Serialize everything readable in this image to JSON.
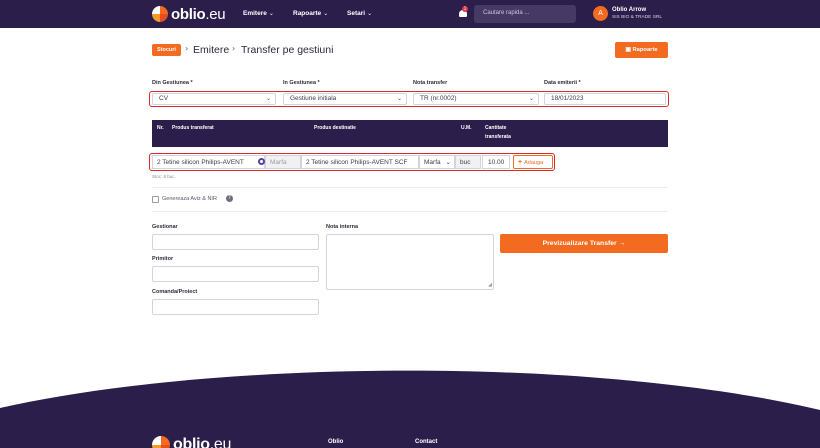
{
  "nav": {
    "logo_brand": "oblio",
    "logo_tld": ".eu",
    "menu": [
      {
        "label": "Emitere"
      },
      {
        "label": "Rapoarte"
      },
      {
        "label": "Setari"
      }
    ],
    "notification_count": "1",
    "search_placeholder": "Cautare rapida ...",
    "user_initial": "A",
    "user_name": "Oblio Arrow",
    "user_company": "SIS BIO & TRADE SRL"
  },
  "breadcrumb": {
    "badge": "Stocuri",
    "level1": "Emitere",
    "level2": "Transfer pe gestiuni",
    "reports_button": "Rapoarte"
  },
  "form": {
    "from_label": "Din Gestiunea *",
    "from_value": "CV",
    "to_label": "In Gestiunea *",
    "to_value": "Gestiune initiala",
    "note_label": "Nota transfer",
    "note_value": "TR (nr.0002)",
    "date_label": "Data emiterii *",
    "date_value": "18/01/2023"
  },
  "table": {
    "headers": {
      "nr": "Nr.",
      "product_src": "Produs transferat",
      "product_dst": "Produs destinatie",
      "um": "U.M.",
      "qty_line1": "Cantitate",
      "qty_line2": "transferata"
    },
    "row": {
      "product_src": "2 Tetine silicon Philips-AVENT",
      "brand_src": "Marfa",
      "product_dst": "2 Tetine silicon Philips-AVENT SCF",
      "type_dst": "Marfa",
      "um": "buc",
      "qty": "10.00",
      "add_button": "Adauga"
    },
    "stock_note": "Stoc: 8 buc."
  },
  "options": {
    "generate_label": "Genereaza Aviz & NIR",
    "gestionar_label": "Gestionar",
    "primitor_label": "Primitor",
    "comanda_label": "Comanda/Proiect",
    "nota_interna_label": "Nota interna",
    "preview_button": "Previzualizare Transfer"
  },
  "footer": {
    "col1": "Oblio",
    "col2": "Contact"
  },
  "colors": {
    "brand_dark": "#2b1e4a",
    "accent": "#f26b21",
    "highlight": "#e02a2a"
  }
}
